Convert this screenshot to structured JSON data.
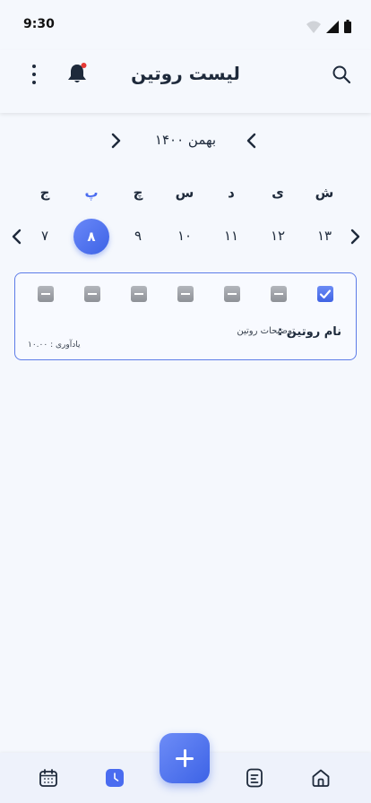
{
  "status": {
    "time": "9:30"
  },
  "header": {
    "title": "لیست روتین"
  },
  "month": {
    "label": "بهمن ۱۴۰۰"
  },
  "weekdays": [
    "ش",
    "ی",
    "د",
    "س",
    "چ",
    "پ",
    "ج"
  ],
  "dates": [
    "۱۳",
    "۱۲",
    "۱۱",
    "۱۰",
    "۹",
    "۸",
    "۷"
  ],
  "selected_date": "۸",
  "routine": {
    "name": "نام روتین :",
    "description": "توضیحات روتین",
    "reminder": "یادآوری : ۱۰.۰۰",
    "checks": [
      "checked",
      "mixed",
      "mixed",
      "mixed",
      "mixed",
      "mixed",
      "mixed"
    ]
  },
  "colors": {
    "accent": "#4a6cf0",
    "text": "#1e2a3b",
    "background": "#f5f8fd",
    "notification": "#e53935"
  },
  "bottom_nav": [
    "home-icon",
    "notes-icon",
    "add-icon",
    "clock-icon",
    "calendar-icon"
  ]
}
